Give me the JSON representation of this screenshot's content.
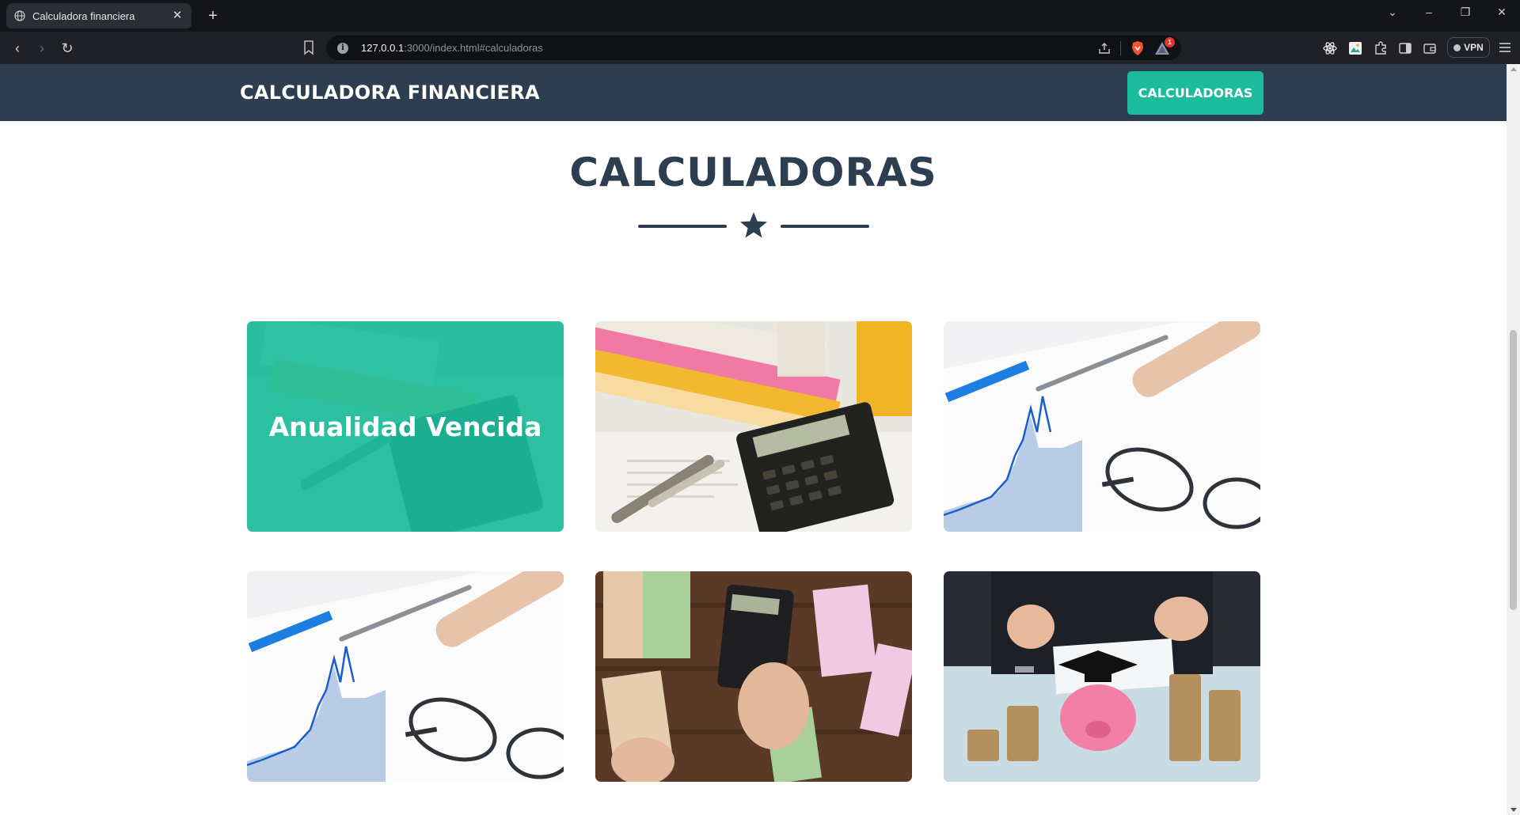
{
  "browser": {
    "tab_title": "Calculadora financiera",
    "url_host": "127.0.0.1",
    "url_rest": ":3000/index.html#calculadoras",
    "rewards_badge": "1",
    "vpn_label": "VPN"
  },
  "site": {
    "brand": "CALCULADORA FINANCIERA",
    "nav_button": "CALCULADORAS",
    "section_title": "CALCULADORAS",
    "colors": {
      "primary": "#2c3e50",
      "accent": "#1abc9c"
    }
  },
  "cards": [
    {
      "image": "income-tax-calculator-photo",
      "overlay_label": "Anualidad Vencida"
    },
    {
      "image": "income-tax-calculator-photo"
    },
    {
      "image": "chart-pen-glasses-photo"
    },
    {
      "image": "chart-pen-glasses-photo"
    },
    {
      "image": "euro-banknotes-calculator-photo"
    },
    {
      "image": "piggy-bank-coins-photo"
    }
  ]
}
